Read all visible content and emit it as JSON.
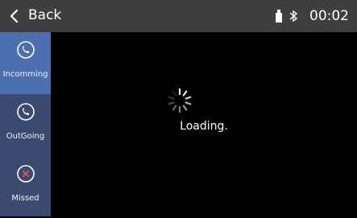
{
  "header": {
    "back_label": "Back",
    "time": "00:02",
    "icons": [
      "chevron-left-icon",
      "usb-icon",
      "bluetooth-icon"
    ]
  },
  "sidebar": {
    "tabs": [
      {
        "label": "Incomming",
        "icon": "incoming-call-icon",
        "active": true
      },
      {
        "label": "OutGoing",
        "icon": "outgoing-call-icon",
        "active": false
      },
      {
        "label": "Missed",
        "icon": "missed-call-icon",
        "active": false
      }
    ]
  },
  "main": {
    "loading_text": "Loading."
  },
  "colors": {
    "topbar": "#3f3f3f",
    "sidebar": "#3b4a6e",
    "active_tab": "#4c6fb0",
    "missed_accent": "#e05050",
    "background": "#000000"
  }
}
